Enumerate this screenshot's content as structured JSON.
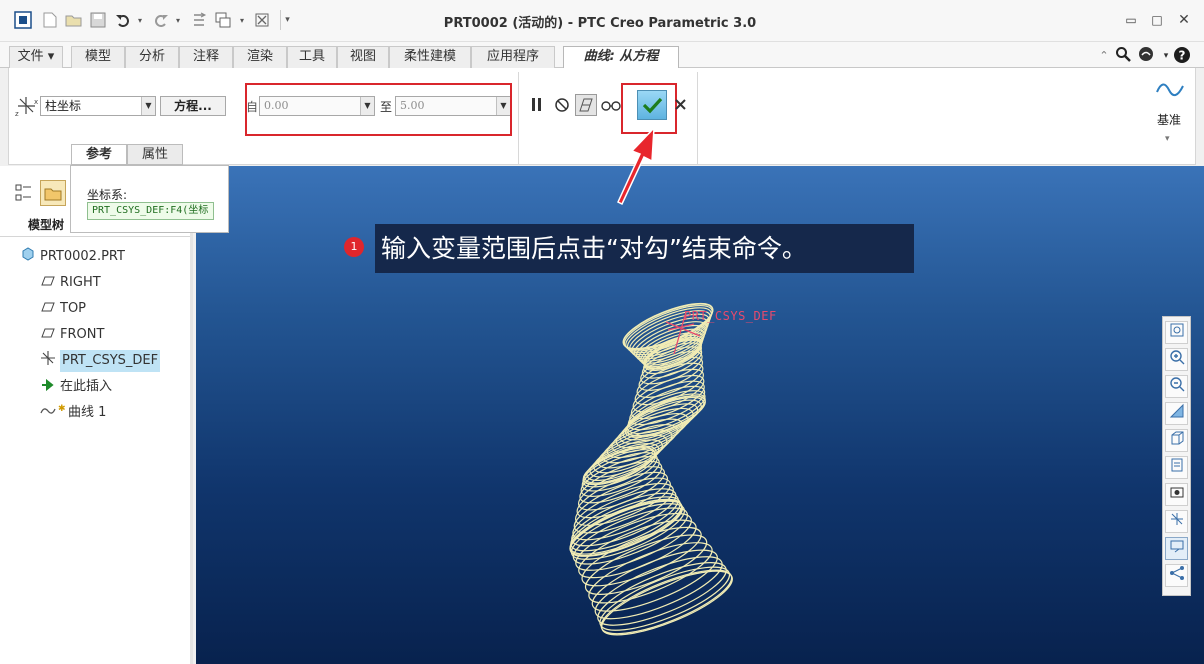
{
  "window": {
    "title": "PRT0002 (活动的) - PTC Creo Parametric 3.0"
  },
  "ribbon_tabs": [
    {
      "label": "文件 ▾"
    },
    {
      "label": "模型"
    },
    {
      "label": "分析"
    },
    {
      "label": "注释"
    },
    {
      "label": "渲染"
    },
    {
      "label": "工具"
    },
    {
      "label": "视图"
    },
    {
      "label": "柔性建模"
    },
    {
      "label": "应用程序"
    },
    {
      "label": "曲线: 从方程"
    }
  ],
  "dashboard": {
    "coordinate_type": "柱坐标",
    "equation_button": "方程...",
    "from_label": "自",
    "from_value": "0.00",
    "to_label": "至",
    "to_value": "5.00",
    "datum_label": "基准",
    "subtabs": [
      "参考",
      "属性"
    ]
  },
  "ref_panel": {
    "csys_label": "坐标系:",
    "csys_value": "PRT_CSYS_DEF:F4(坐标"
  },
  "model_tree": {
    "tab_label": "模型树",
    "items": [
      {
        "label": "PRT0002.PRT",
        "icon": "part-icon"
      },
      {
        "label": "RIGHT",
        "icon": "datum-plane-icon"
      },
      {
        "label": "TOP",
        "icon": "datum-plane-icon"
      },
      {
        "label": "FRONT",
        "icon": "datum-plane-icon"
      },
      {
        "label": "PRT_CSYS_DEF",
        "icon": "csys-icon"
      },
      {
        "label": "在此插入",
        "icon": "insert-arrow-icon"
      },
      {
        "label": "曲线 1",
        "icon": "curve-icon"
      }
    ]
  },
  "viewport": {
    "callout_number": "1",
    "callout_text": "输入变量范围后点击“对勾”结束命令。",
    "csys_annotation": "PRT_CSYS_DEF"
  },
  "colors": {
    "accent_red": "#d9262c",
    "callout_bg": "#15284b",
    "curve_color": "#f1ecb4",
    "check_bg": "#6fc0e8"
  }
}
